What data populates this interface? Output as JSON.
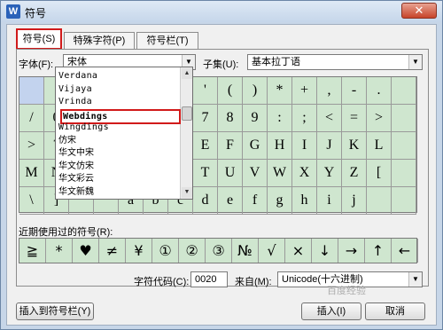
{
  "window": {
    "title": "符号",
    "app_icon": "W",
    "close_label": "✕"
  },
  "tabs": [
    {
      "label": "符号(S)",
      "active": true
    },
    {
      "label": "特殊字符(P)",
      "active": false
    },
    {
      "label": "符号栏(T)",
      "active": false
    }
  ],
  "font": {
    "label": "字体(F):",
    "value": "宋体"
  },
  "subset": {
    "label": "子集(U):",
    "value": "基本拉丁语"
  },
  "font_dropdown": {
    "items": [
      "Verdana",
      "Vijaya",
      "Vrinda",
      "Webdings",
      "Wingdings",
      "仿宋",
      "华文中宋",
      "华文仿宋",
      "华文彩云",
      "华文新魏"
    ],
    "highlighted": "Webdings"
  },
  "symbol_grid": {
    "rows": [
      [
        "",
        "!",
        "",
        "",
        "",
        "",
        "",
        "'",
        "(",
        ")",
        "*",
        "+",
        ",",
        "-",
        ".",
        ""
      ],
      [
        "/",
        "0",
        "",
        "",
        "",
        "",
        "",
        "7",
        "8",
        "9",
        ":",
        ";",
        "<",
        "=",
        ">",
        ""
      ],
      [
        ">",
        "?",
        "",
        "",
        "",
        "",
        "",
        "E",
        "F",
        "G",
        "H",
        "I",
        "J",
        "K",
        "L",
        ""
      ],
      [
        "M",
        "N",
        "",
        "",
        "",
        "",
        "",
        "T",
        "U",
        "V",
        "W",
        "X",
        "Y",
        "Z",
        "[",
        ""
      ],
      [
        "\\",
        "]",
        "",
        "",
        "a",
        "b",
        "c",
        "d",
        "e",
        "f",
        "g",
        "h",
        "i",
        "j",
        "",
        ""
      ]
    ]
  },
  "recent": {
    "label": "近期使用过的符号(R):",
    "symbols": [
      "≧",
      "*",
      "♥",
      "≠",
      "¥",
      "①",
      "②",
      "③",
      "№",
      "√",
      "×",
      "↓",
      "→",
      "↑",
      "←"
    ]
  },
  "char_code": {
    "label": "字符代码(C):",
    "value": "0020"
  },
  "from": {
    "label": "来自(M):",
    "value": "Unicode(十六进制)"
  },
  "buttons": {
    "insert_to_bar": "插入到符号栏(Y)",
    "insert": "插入(I)",
    "cancel": "取消"
  },
  "watermark": "百度经验"
}
